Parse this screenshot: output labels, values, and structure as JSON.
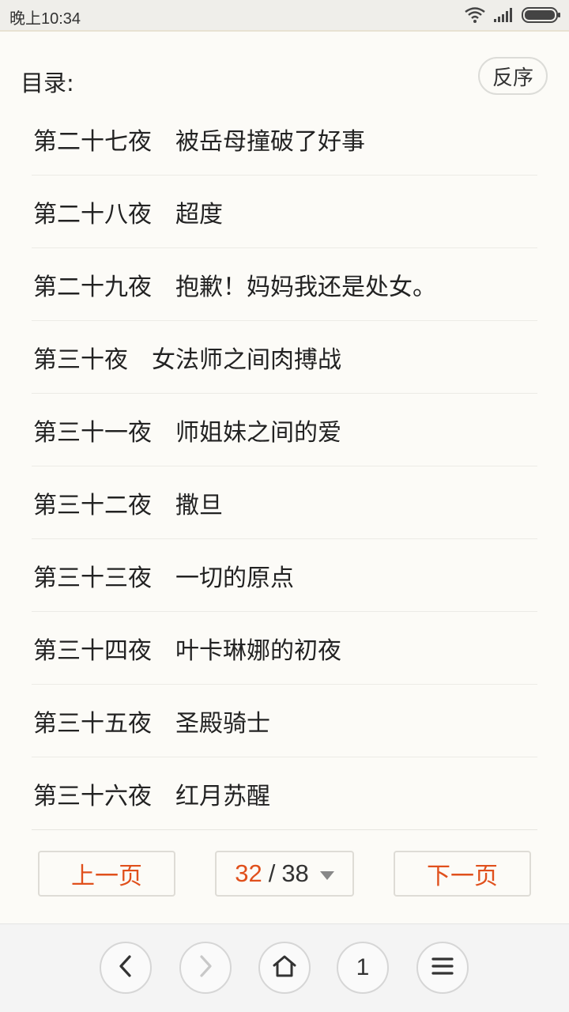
{
  "status_bar": {
    "time": "晚上10:34",
    "icons": [
      "wifi-icon",
      "signal-icon",
      "battery-icon"
    ]
  },
  "header": {
    "title": "目录:",
    "reverse_label": "反序"
  },
  "chapters": [
    {
      "label": "第二十七夜　被岳母撞破了好事"
    },
    {
      "label": "第二十八夜　超度"
    },
    {
      "label": "第二十九夜　抱歉！妈妈我还是处女。"
    },
    {
      "label": "第三十夜　女法师之间肉搏战"
    },
    {
      "label": "第三十一夜　师姐妹之间的爱"
    },
    {
      "label": "第三十二夜　撒旦"
    },
    {
      "label": "第三十三夜　一切的原点"
    },
    {
      "label": "第三十四夜　叶卡琳娜的初夜"
    },
    {
      "label": "第三十五夜　圣殿骑士"
    },
    {
      "label": "第三十六夜　红月苏醒"
    }
  ],
  "pager": {
    "prev_label": "上一页",
    "next_label": "下一页",
    "current_page": "32",
    "separator": "/",
    "total_pages": "38"
  },
  "bottom_nav": {
    "tab_count": "1",
    "icons": [
      "back-icon",
      "forward-icon",
      "home-icon",
      "tabs-icon",
      "menu-icon"
    ]
  },
  "colors": {
    "accent": "#e0501c",
    "background": "#fcfbf7"
  }
}
